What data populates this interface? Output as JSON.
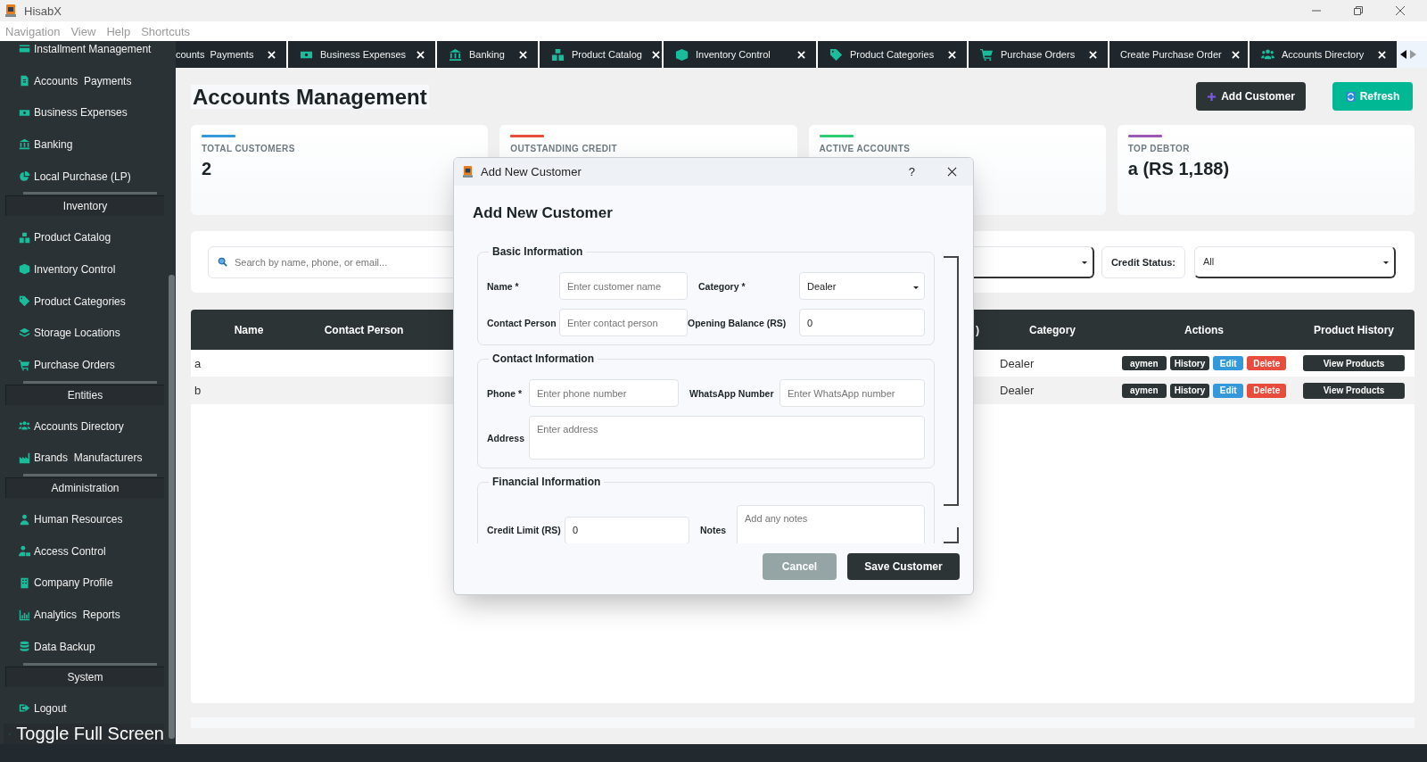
{
  "app": {
    "title": "HisabX"
  },
  "menu": [
    "Navigation",
    "View",
    "Help",
    "Shortcuts"
  ],
  "sidebar": {
    "entries": [
      {
        "kind": "item",
        "label": "Installment Management"
      },
      {
        "kind": "item",
        "label": "Accounts  Payments"
      },
      {
        "kind": "item",
        "label": "Business Expenses"
      },
      {
        "kind": "item",
        "label": "Banking"
      },
      {
        "kind": "item",
        "label": "Local Purchase (LP)"
      },
      {
        "kind": "section",
        "label": "Inventory"
      },
      {
        "kind": "item",
        "label": "Product Catalog"
      },
      {
        "kind": "item",
        "label": "Inventory Control"
      },
      {
        "kind": "item",
        "label": "Product Categories"
      },
      {
        "kind": "item",
        "label": "Storage Locations"
      },
      {
        "kind": "item",
        "label": "Purchase Orders"
      },
      {
        "kind": "section",
        "label": "Entities"
      },
      {
        "kind": "item",
        "label": "Accounts Directory"
      },
      {
        "kind": "item",
        "label": "Brands  Manufacturers"
      },
      {
        "kind": "section",
        "label": "Administration"
      },
      {
        "kind": "item",
        "label": "Human Resources"
      },
      {
        "kind": "item",
        "label": "Access Control"
      },
      {
        "kind": "item",
        "label": "Company Profile"
      },
      {
        "kind": "item",
        "label": "Analytics  Reports"
      },
      {
        "kind": "item",
        "label": "Data Backup"
      },
      {
        "kind": "section",
        "label": "System"
      },
      {
        "kind": "item",
        "label": "Logout"
      }
    ],
    "toggle": "Toggle Full Screen"
  },
  "tabs": [
    {
      "label": "counts  Payments"
    },
    {
      "label": "Business Expenses"
    },
    {
      "label": "Banking"
    },
    {
      "label": "Product Catalog"
    },
    {
      "label": "Inventory Control"
    },
    {
      "label": "Product Categories"
    },
    {
      "label": "Purchase Orders"
    },
    {
      "label": "Create Purchase Order"
    },
    {
      "label": "Accounts Directory"
    }
  ],
  "page": {
    "title": "Accounts Management",
    "buttons": [
      {
        "kind": "add",
        "label": "Add Customer"
      },
      {
        "kind": "refresh",
        "label": "Refresh"
      }
    ]
  },
  "cards": [
    {
      "label": "TOTAL CUSTOMERS",
      "value": "2",
      "color": "#3498db"
    },
    {
      "label": "OUTSTANDING CREDIT",
      "color": "#e74c3c"
    },
    {
      "label": "ACTIVE ACCOUNTS",
      "color": "#2ecc71"
    },
    {
      "label": "TOP DEBTOR",
      "value": "a (RS 1,188)",
      "color": "#9b59b6"
    }
  ],
  "filters": {
    "search": {
      "placeholder": "Search by name, phone, or email..."
    },
    "credit_status": {
      "label": "Credit Status:",
      "value": "All"
    }
  },
  "table": {
    "columns": [
      "Name",
      "Contact Person",
      ")",
      "Category",
      "Actions",
      "Product History"
    ],
    "rows": [
      {
        "name": "a",
        "category": "Dealer",
        "actions": [
          {
            "kind": "payment",
            "label": "aymen"
          },
          {
            "kind": "history",
            "label": "History"
          },
          {
            "kind": "edit",
            "label": "Edit"
          },
          {
            "kind": "delete",
            "label": "Delete"
          }
        ],
        "history": "View Products"
      },
      {
        "name": "b",
        "category": "Dealer",
        "actions": [
          {
            "kind": "payment",
            "label": "aymen"
          },
          {
            "kind": "history",
            "label": "History"
          },
          {
            "kind": "edit",
            "label": "Edit"
          },
          {
            "kind": "delete",
            "label": "Delete"
          }
        ],
        "history": "View Products"
      }
    ]
  },
  "dialog": {
    "title": "Add New Customer",
    "help": "?",
    "heading": "Add New Customer",
    "groups": [
      {
        "title": "Basic Information",
        "fields": [
          {
            "label": "Name *",
            "kind": "text",
            "placeholder": "Enter customer name"
          },
          {
            "label": "Category *",
            "kind": "select",
            "value": "Dealer"
          },
          {
            "label": "Contact Person",
            "kind": "text",
            "placeholder": "Enter contact person"
          },
          {
            "label": "Opening Balance (RS)",
            "kind": "text",
            "value": "0"
          }
        ]
      },
      {
        "title": "Contact Information",
        "fields": [
          {
            "label": "Phone *",
            "kind": "text",
            "placeholder": "Enter phone number"
          },
          {
            "label": "WhatsApp Number",
            "kind": "text",
            "placeholder": "Enter WhatsApp number"
          },
          {
            "label": "Address",
            "kind": "textarea",
            "placeholder": "Enter address"
          }
        ]
      },
      {
        "title": "Financial Information",
        "fields": [
          {
            "label": "Credit Limit (RS)",
            "kind": "text",
            "value": "0"
          },
          {
            "label": "Notes",
            "kind": "textarea",
            "placeholder": "Add any notes"
          }
        ]
      }
    ],
    "buttons": [
      {
        "kind": "secondary",
        "label": "Cancel"
      },
      {
        "kind": "primary",
        "label": "Save Customer"
      }
    ]
  }
}
